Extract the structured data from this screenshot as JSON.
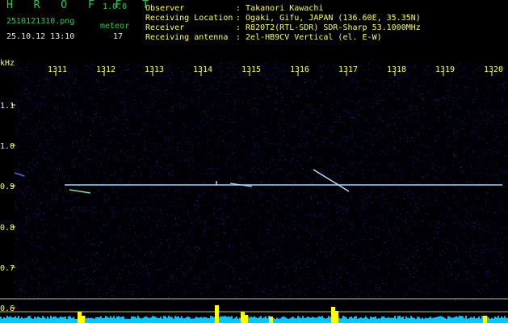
{
  "app": {
    "name": "H R O F F T",
    "version": "1.0.0",
    "filename": "2510121310.png",
    "datetime": "25.10.12 13:10",
    "counter_label": "meteor",
    "counter_value": "17"
  },
  "info": {
    "rows": [
      {
        "label": "Observer",
        "value": ": Takanori Kawachi"
      },
      {
        "label": "Receiving Location",
        "value": ": Ogaki, Gifu, JAPAN (136.60E, 35.35N)"
      },
      {
        "label": "Receiver",
        "value": ": R820T2(RTL-SDR) SDR-Sharp 53.1000MHz"
      },
      {
        "label": "Receiving antenna",
        "value": ": 2el-HB9CV Vertical (el. E-W)"
      }
    ]
  },
  "axes": {
    "y_unit": "kHz",
    "time_ticks": [
      "1311",
      "1312",
      "1313",
      "1314",
      "1315",
      "1316",
      "1317",
      "1318",
      "1319",
      "1320"
    ],
    "freq_ticks": [
      "1.1",
      "1.0",
      "0.9",
      "0.8",
      "0.7",
      "0.6"
    ]
  },
  "colors": {
    "background": "#000000",
    "noise": "#1a2a8a",
    "carrier": "#9fd8ff",
    "spectrum": "#00c8ff",
    "peak": "#ffff00",
    "tick_text": "#ffff55"
  }
}
